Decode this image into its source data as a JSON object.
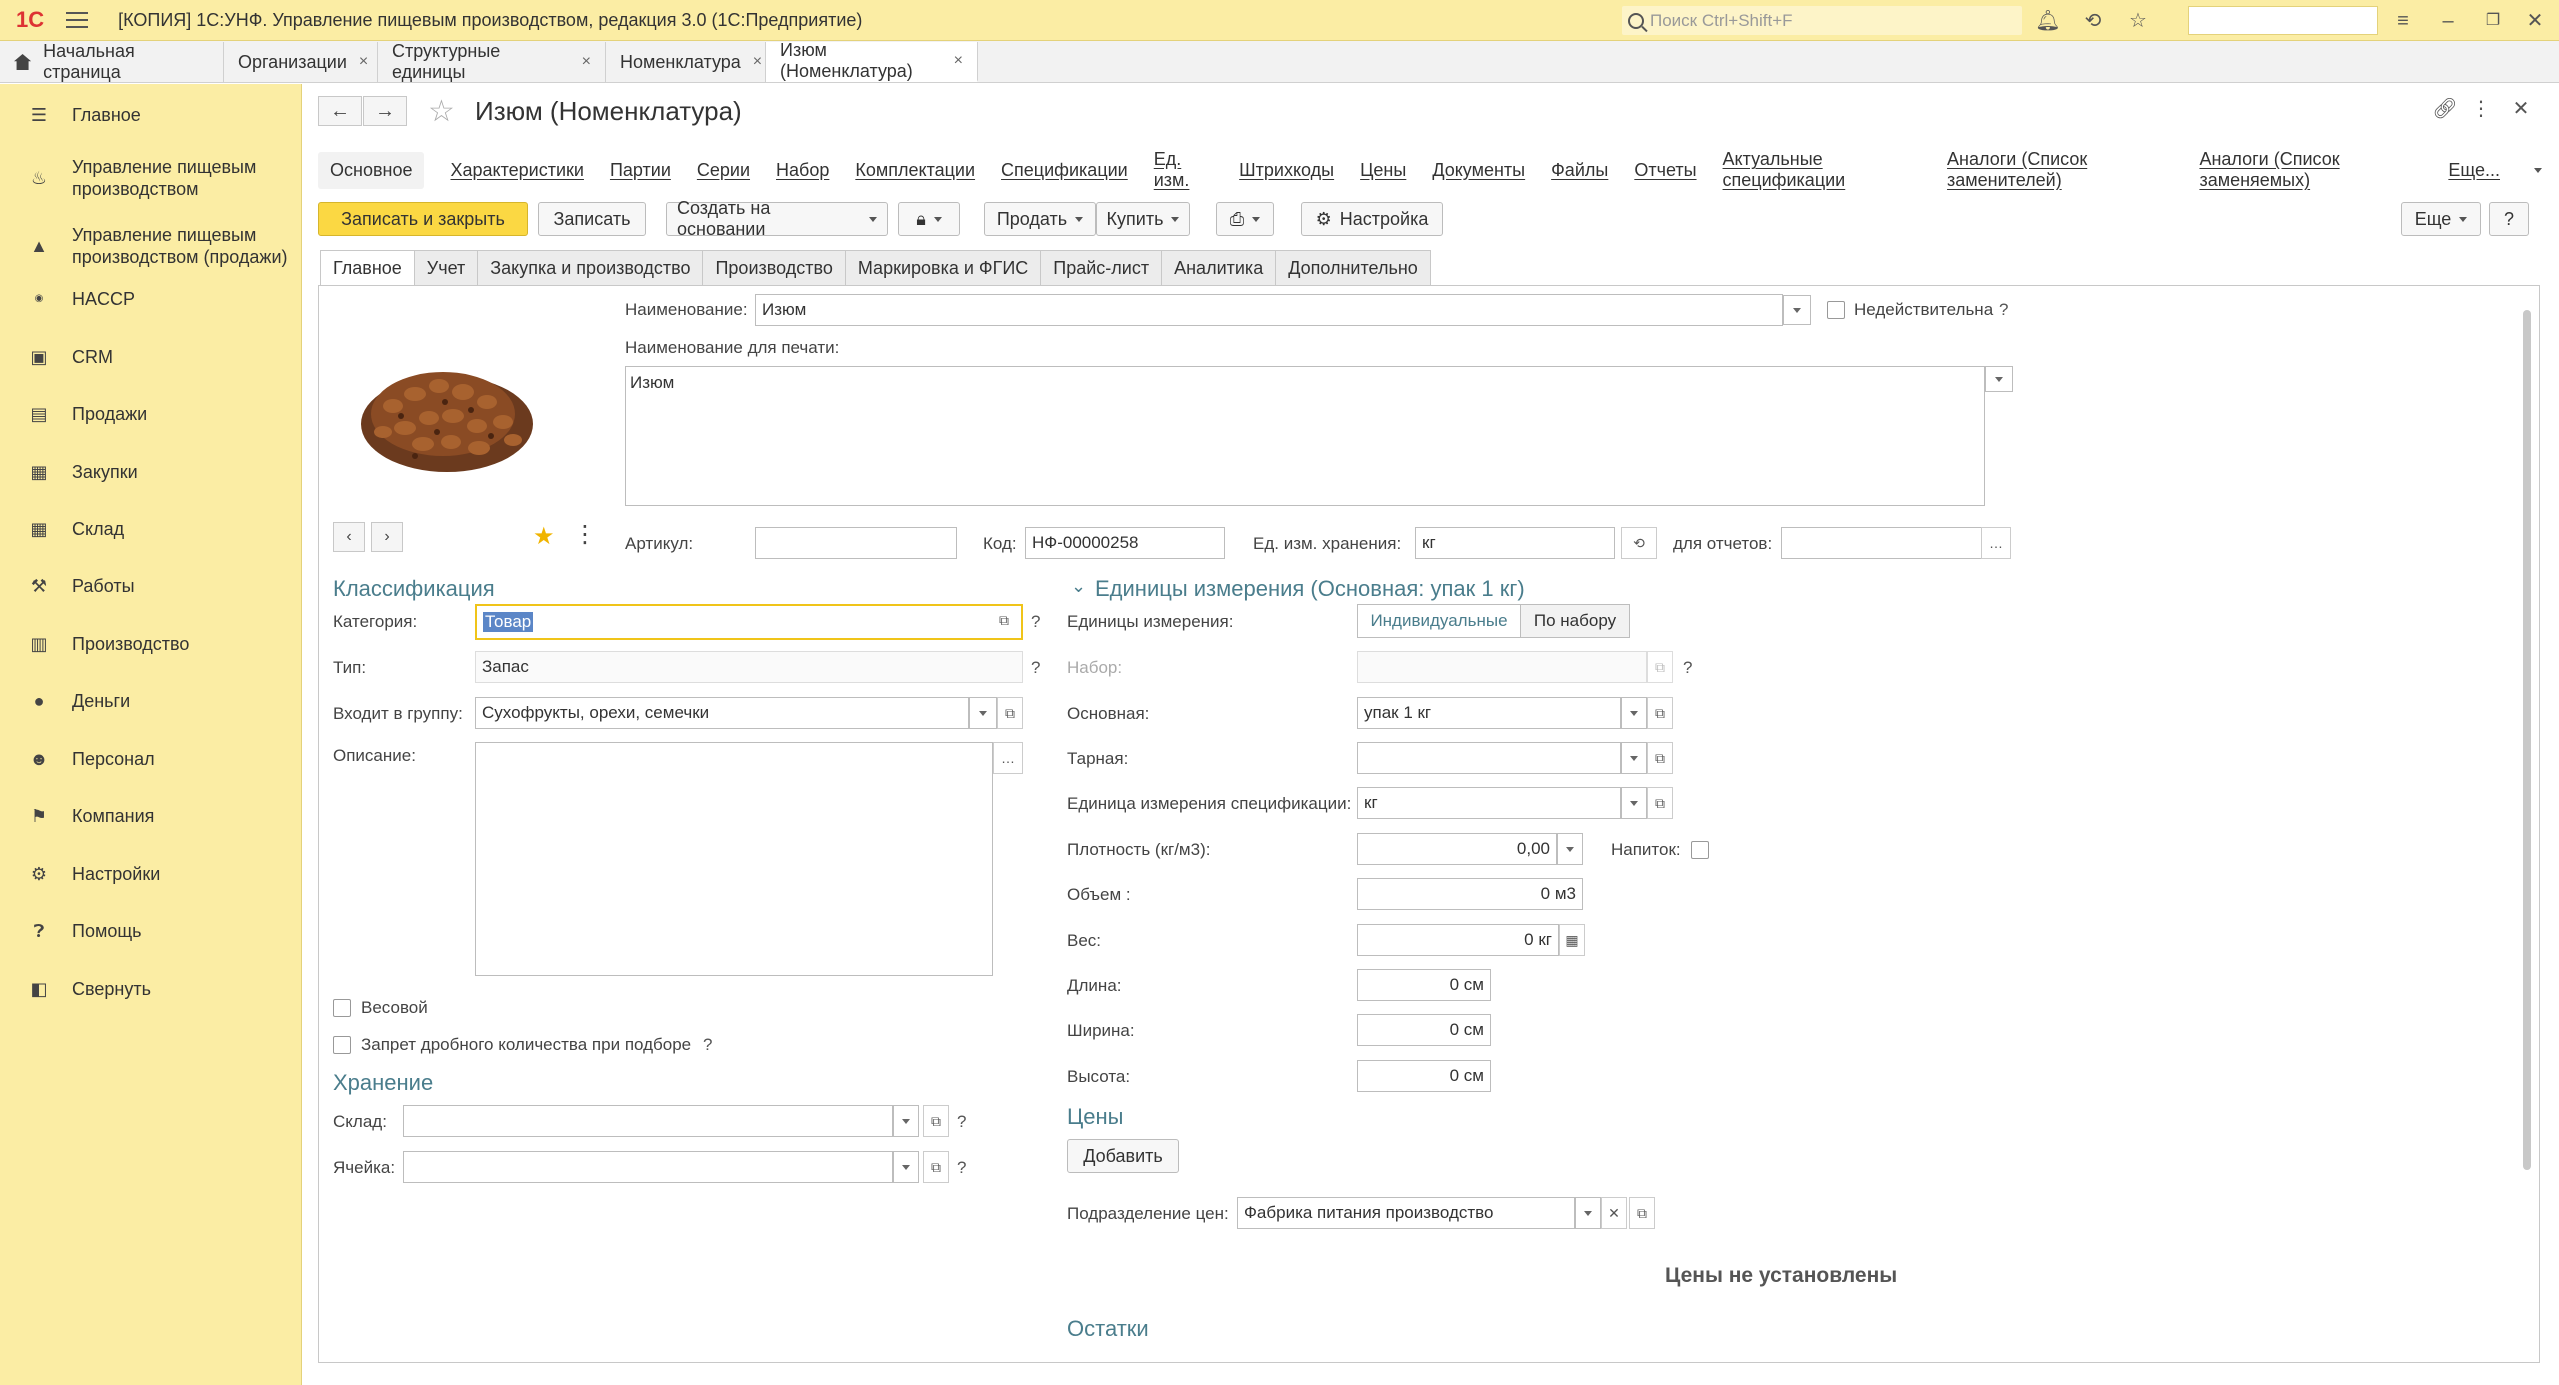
{
  "titlebar": {
    "logo": "1С",
    "title": "[КОПИЯ] 1С:УНФ. Управление пищевым производством, редакция 3.0  (1С:Предприятие)",
    "search_placeholder": "Поиск Ctrl+Shift+F"
  },
  "open_tabs": [
    {
      "label": "Начальная страница"
    },
    {
      "label": "Организации",
      "close": "×"
    },
    {
      "label": "Структурные единицы",
      "close": "×"
    },
    {
      "label": "Номенклатура",
      "close": "×"
    },
    {
      "label": "Изюм (Номенклатура)",
      "close": "×"
    }
  ],
  "sidebar": {
    "items": [
      {
        "label": "Главное",
        "icon": "menu-icon"
      },
      {
        "label": "Управление пищевым производством",
        "icon": "pot-icon"
      },
      {
        "label": "Управление пищевым производством (продажи)",
        "icon": "bell-icon"
      },
      {
        "label": "HACCP",
        "icon": "haccp-icon"
      },
      {
        "label": "CRM",
        "icon": "crm-icon"
      },
      {
        "label": "Продажи",
        "icon": "cart-icon"
      },
      {
        "label": "Закупки",
        "icon": "purchase-icon"
      },
      {
        "label": "Склад",
        "icon": "warehouse-icon"
      },
      {
        "label": "Работы",
        "icon": "tools-icon"
      },
      {
        "label": "Производство",
        "icon": "factory-icon"
      },
      {
        "label": "Деньги",
        "icon": "money-icon"
      },
      {
        "label": "Персонал",
        "icon": "person-icon"
      },
      {
        "label": "Компания",
        "icon": "flag-icon"
      },
      {
        "label": "Настройки",
        "icon": "gear-icon"
      },
      {
        "label": "Помощь",
        "icon": "help-icon"
      },
      {
        "label": "Свернуть",
        "icon": "collapse-icon"
      }
    ]
  },
  "form": {
    "title": "Изюм (Номенклатура)",
    "nav_tabs": [
      "Основное",
      "Характеристики",
      "Партии",
      "Серии",
      "Набор",
      "Комплектации",
      "Спецификации",
      "Ед. изм.",
      "Штрихкоды",
      "Цены",
      "Документы",
      "Файлы",
      "Отчеты",
      "Актуальные спецификации",
      "Аналоги (Список заменителей)",
      "Аналоги (Список заменяемых)",
      "Еще..."
    ],
    "toolbar": {
      "save_close": "Записать и закрыть",
      "save": "Записать",
      "create_based": "Создать на основании",
      "sell": "Продать",
      "buy": "Купить",
      "settings": "Настройка",
      "more": "Еще",
      "help": "?"
    },
    "section_tabs": [
      "Главное",
      "Учет",
      "Закупка и производство",
      "Производство",
      "Маркировка и ФГИС",
      "Прайс-лист",
      "Аналитика",
      "Дополнительно"
    ],
    "fields": {
      "name_label": "Наименование:",
      "name_value": "Изюм",
      "invalid_label": "Недействительна",
      "print_name_label": "Наименование для печати:",
      "print_name_value": "Изюм",
      "article_label": "Артикул:",
      "article_value": "",
      "code_label": "Код:",
      "code_value": "НФ-00000258",
      "storage_unit_label": "Ед. изм. хранения:",
      "storage_unit_value": "кг",
      "for_reports_label": "для отчетов:",
      "for_reports_value": ""
    },
    "classification": {
      "heading": "Классификация",
      "category_label": "Категория:",
      "category_value": "Товар",
      "type_label": "Тип:",
      "type_value": "Запас",
      "group_label": "Входит в группу:",
      "group_value": "Сухофрукты, орехи, семечки",
      "description_label": "Описание:",
      "weighted_label": "Весовой",
      "fraction_ban_label": "Запрет дробного количества при подборе"
    },
    "storage": {
      "heading": "Хранение",
      "warehouse_label": "Склад:",
      "warehouse_value": "",
      "cell_label": "Ячейка:",
      "cell_value": ""
    },
    "units": {
      "heading": "Единицы измерения (Основная: упак 1 кг)",
      "units_label": "Единицы измерения:",
      "toggle_individual": "Индивидуальные",
      "toggle_set": "По набору",
      "set_label": "Набор:",
      "set_value": "",
      "main_label": "Основная:",
      "main_value": "упак 1 кг",
      "tare_label": "Тарная:",
      "tare_value": "",
      "spec_unit_label": "Единица измерения спецификации:",
      "spec_unit_value": "кг",
      "density_label": "Плотность (кг/м3):",
      "density_value": "0,00",
      "drink_label": "Напиток:",
      "volume_label": "Объем :",
      "volume_value": "0  м3",
      "weight_label": "Вес:",
      "weight_value": "0 кг",
      "length_label": "Длина:",
      "length_value": "0 см",
      "width_label": "Ширина:",
      "width_value": "0 см",
      "height_label": "Высота:",
      "height_value": "0 см"
    },
    "prices": {
      "heading": "Цены",
      "add_button": "Добавить",
      "division_label": "Подразделение цен:",
      "division_value": "Фабрика питания производство",
      "empty_text": "Цены не установлены"
    },
    "remains_heading": "Остатки"
  },
  "colors": {
    "sidebar_bg": "#fbeda4",
    "primary_button": "#fbd843",
    "section_heading": "#4a7d8c",
    "focus_border": "#f0c419"
  }
}
